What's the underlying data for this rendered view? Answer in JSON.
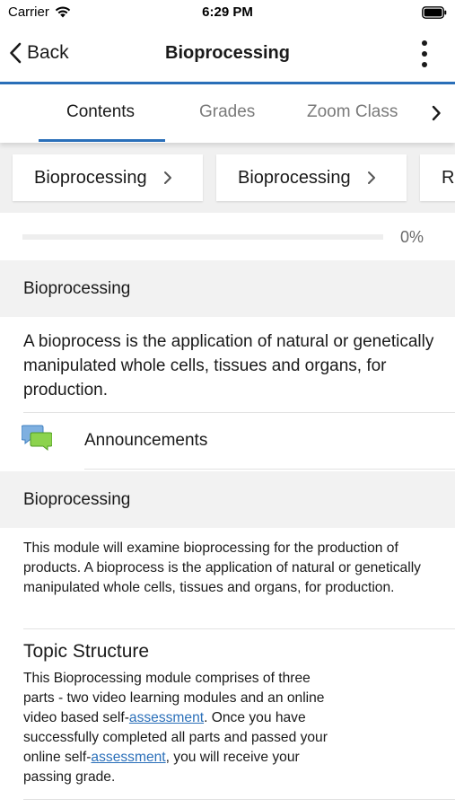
{
  "status_bar": {
    "carrier": "Carrier",
    "time": "6:29 PM"
  },
  "nav": {
    "back_label": "Back",
    "title": "Bioprocessing"
  },
  "tabs": [
    {
      "label": "Contents",
      "active": true
    },
    {
      "label": "Grades",
      "active": false
    },
    {
      "label": "Zoom Class",
      "active": false
    }
  ],
  "breadcrumbs": [
    {
      "label": "Bioprocessing"
    },
    {
      "label": "Bioprocessing"
    },
    {
      "label": "Re"
    }
  ],
  "progress": {
    "value": 0,
    "text": "0%"
  },
  "sections": [
    {
      "header": "Bioprocessing",
      "description": "A bioprocess is the application of natural or genetically manipulated whole cells, tissues and organs, for production.",
      "announcement_label": "Announcements"
    },
    {
      "header": "Bioprocessing",
      "description": "This module will examine bioprocessing for the production of products. A bioprocess is the application of natural or genetically manipulated whole cells, tissues and organs, for production.",
      "topic": {
        "title": "Topic Structure",
        "line1": "This Bioprocessing module comprises of three",
        "line2": "parts - two video learning modules and an online",
        "line3_pre": "video based self-",
        "line3_link": "assessment",
        "line3_post": ". Once you have",
        "line4": "successfully completed all parts and passed your",
        "line5_pre": "online self-",
        "line5_link": "assessment",
        "line5_post": ", you will receive your",
        "line6": "passing grade."
      }
    }
  ],
  "colors": {
    "accent": "#2a6fb9",
    "section_bg": "#f2f2f2",
    "strip_bg": "#f0f0f0"
  },
  "icons": [
    "wifi-icon",
    "battery-icon",
    "back-chevron-icon",
    "more-vertical-icon",
    "chevron-right-icon",
    "chat-bubbles-icon"
  ]
}
